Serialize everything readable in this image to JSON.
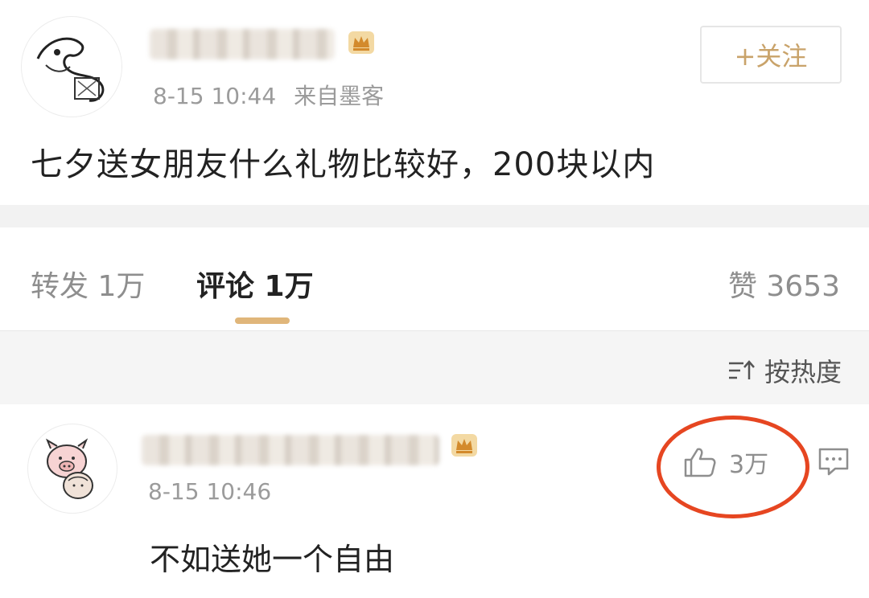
{
  "post": {
    "username": "",
    "date": "8-15 10:44",
    "source": "来自墨客",
    "follow_label": "+关注",
    "text": "七夕送女朋友什么礼物比较好，200块以内"
  },
  "tabs": {
    "repost": "转发 1万",
    "comment": "评论 1万",
    "like": "赞 3653"
  },
  "sort": {
    "label": "按热度",
    "icon": "sort-icon"
  },
  "comment": {
    "username": "",
    "date": "8-15 10:46",
    "text": "不如送她一个自由",
    "like_count": "3万"
  },
  "colors": {
    "accent_gold": "#c9a36a",
    "underline": "#e0b67a",
    "highlight_circle": "#e64621",
    "meta_gray": "#9b9b9b"
  }
}
